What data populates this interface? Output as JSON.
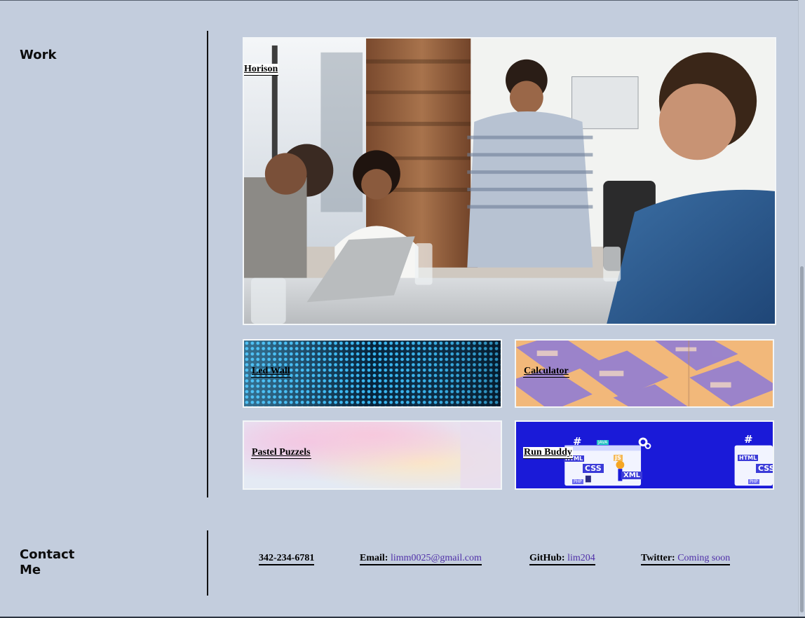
{
  "work": {
    "title": "Work",
    "projects": [
      {
        "label": "Horison"
      },
      {
        "label": "Led Wall"
      },
      {
        "label": "Calculator"
      },
      {
        "label": "Pastel Puzzels"
      },
      {
        "label": "Run Buddy",
        "image_text": [
          "HTML",
          "JS",
          "CSS",
          "XML",
          "PHP",
          "JAVA",
          "HTML",
          "CSS",
          "PHP"
        ]
      }
    ]
  },
  "contact": {
    "title_line1": "Contact",
    "title_line2": "Me",
    "phone": "342-234-6781",
    "email_label": "Email:",
    "email_value": "limm0025@gmail.com",
    "github_label": "GitHub:",
    "github_value": "lim204",
    "twitter_label": "Twitter:",
    "twitter_value": "Coming soon"
  },
  "colors": {
    "background": "#c3cddd",
    "link": "#4f2fa8",
    "divider": "#111111"
  }
}
